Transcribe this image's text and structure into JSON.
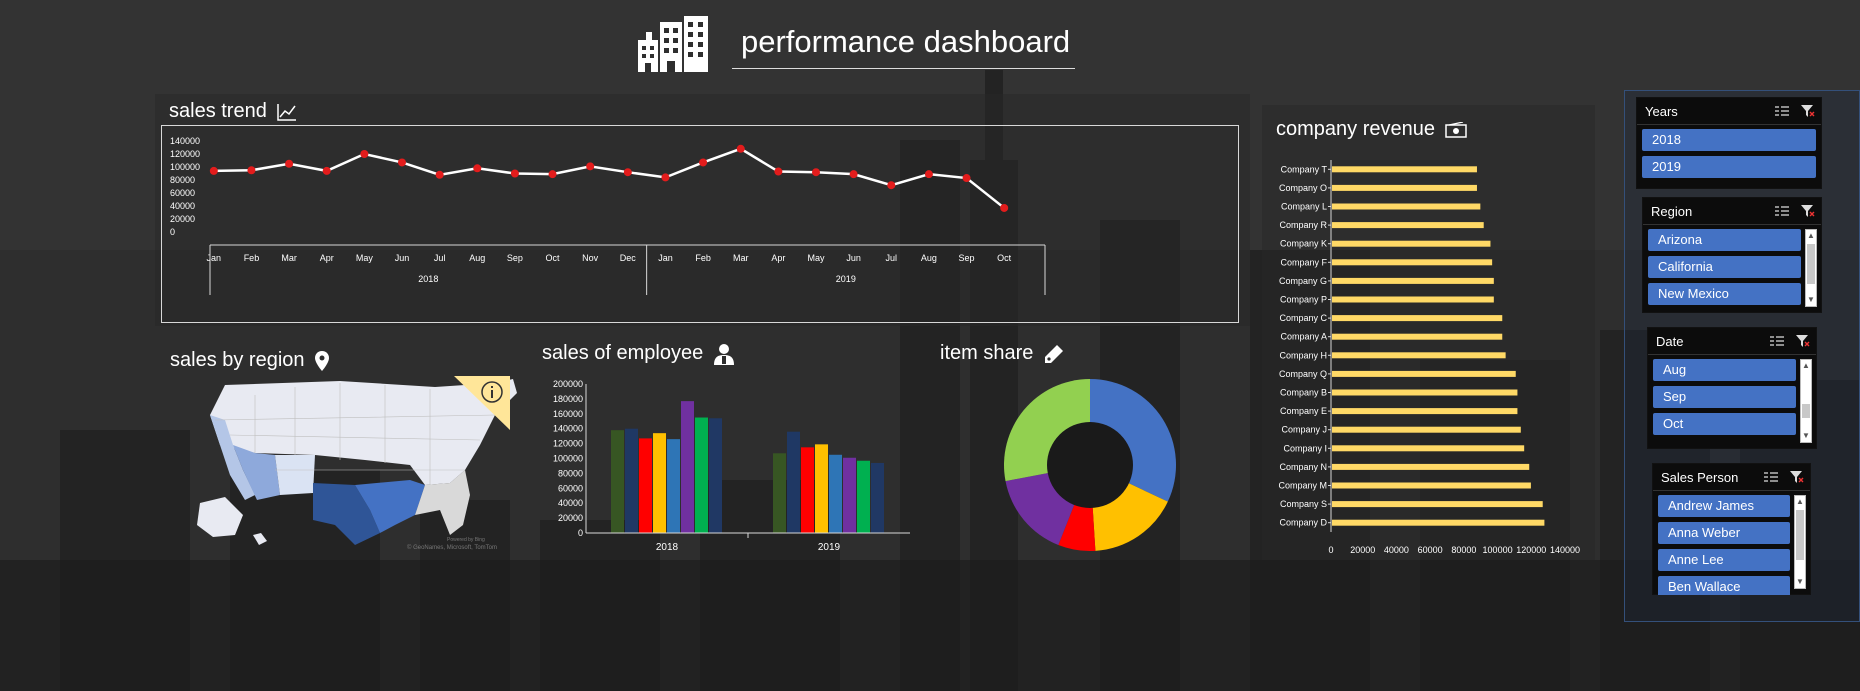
{
  "dashboard": {
    "title": "performance dashboard"
  },
  "sections": {
    "sales_trend": "sales trend",
    "sales_by_region": "sales by region",
    "sales_of_employee": "sales of employee",
    "item_share": "item share",
    "company_revenue": "company revenue"
  },
  "map_credits": {
    "line1": "Powered by Bing",
    "line2": "© GeoNames, Microsoft, TomTom"
  },
  "slicers": {
    "years": {
      "title": "Years",
      "items": [
        "2018",
        "2019"
      ]
    },
    "region": {
      "title": "Region",
      "items": [
        "Arizona",
        "California",
        "New Mexico"
      ]
    },
    "date": {
      "title": "Date",
      "items": [
        "Aug",
        "Sep",
        "Oct"
      ]
    },
    "sales_person": {
      "title": "Sales Person",
      "items": [
        "Andrew James",
        "Anna Weber",
        "Anne Lee",
        "Ben Wallace"
      ]
    }
  },
  "colors": {
    "accent_blue": "#4472c4",
    "line_point": "#e31c1c",
    "bar_gold": "#ffd966",
    "panel_bg": "rgba(40,40,40,0.55)"
  },
  "chart_data": [
    {
      "type": "line",
      "title": "sales trend",
      "ylim": [
        0,
        140000
      ],
      "yticks": [
        "140000",
        "120000",
        "100000",
        "80000",
        "60000",
        "40000",
        "20000",
        "0"
      ],
      "groups": [
        {
          "name": "2018",
          "months": [
            "Jan",
            "Feb",
            "Mar",
            "Apr",
            "May",
            "Jun",
            "Jul",
            "Aug",
            "Sep",
            "Oct",
            "Nov",
            "Dec"
          ]
        },
        {
          "name": "2019",
          "months": [
            "Jan",
            "Feb",
            "Mar",
            "Apr",
            "May",
            "Jun",
            "Jul",
            "Aug",
            "Sep",
            "Oct"
          ]
        }
      ],
      "values": [
        94000,
        95000,
        105000,
        94000,
        120000,
        107000,
        88000,
        98000,
        90000,
        89000,
        101000,
        92000,
        84000,
        107000,
        128000,
        93000,
        92000,
        89000,
        72000,
        89000,
        83000,
        37000
      ]
    },
    {
      "type": "bar",
      "title": "sales of employee",
      "ylim": [
        0,
        200000
      ],
      "yticks": [
        "200000",
        "180000",
        "160000",
        "140000",
        "120000",
        "100000",
        "80000",
        "60000",
        "40000",
        "20000",
        "0"
      ],
      "categories": [
        "2018",
        "2019"
      ],
      "bar_colors": [
        "#375623",
        "#1f3864",
        "#ff0000",
        "#ffc000",
        "#2e75b6",
        "#7030a0",
        "#00b050",
        "#203864"
      ],
      "series_values": [
        [
          138000,
          140000,
          127000,
          134000,
          126000,
          177000,
          155000,
          154000
        ],
        [
          107000,
          136000,
          115000,
          119000,
          105000,
          101000,
          97000,
          94000
        ]
      ]
    },
    {
      "type": "pie",
      "title": "item share",
      "slices": [
        {
          "value": 32,
          "color": "#4472c4"
        },
        {
          "value": 17,
          "color": "#ffc000"
        },
        {
          "value": 7,
          "color": "#ff0000"
        },
        {
          "value": 16,
          "color": "#7030a0"
        },
        {
          "value": 28,
          "color": "#92d050"
        }
      ]
    },
    {
      "type": "bar",
      "orientation": "horizontal",
      "title": "company revenue",
      "xlim": [
        0,
        140000
      ],
      "xticks": [
        "0",
        "20000",
        "40000",
        "60000",
        "80000",
        "100000",
        "120000",
        "140000"
      ],
      "categories": [
        "Company T",
        "Company O",
        "Company L",
        "Company R",
        "Company K",
        "Company F",
        "Company G",
        "Company P",
        "Company C",
        "Company A",
        "Company H",
        "Company Q",
        "Company B",
        "Company E",
        "Company J",
        "Company I",
        "Company N",
        "Company M",
        "Company S",
        "Company D"
      ],
      "values": [
        86000,
        86000,
        88000,
        90000,
        94000,
        95000,
        96000,
        96000,
        101000,
        101000,
        103000,
        109000,
        110000,
        110000,
        112000,
        114000,
        117000,
        118000,
        125000,
        126000
      ]
    }
  ]
}
